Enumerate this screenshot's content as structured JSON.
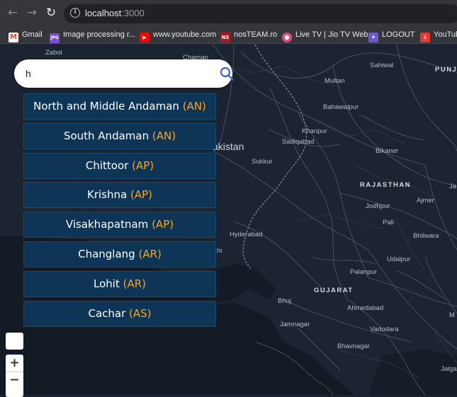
{
  "browser": {
    "url_host": "localhost",
    "url_port": ":3000",
    "bookmarks": [
      {
        "label": "Gmail",
        "icon": "gmail-icon",
        "color": "#ea4335",
        "glyph": "M"
      },
      {
        "label": "Image processing r...",
        "icon": "jpg-icon",
        "color": "#7b4bd8",
        "glyph": "JPG"
      },
      {
        "label": "www.youtube.com",
        "icon": "youtube-icon",
        "color": "#ff0000",
        "glyph": "▶"
      },
      {
        "label": "nosTEAM.ro",
        "icon": "nosteam-icon",
        "color": "#b0151b",
        "glyph": "NS"
      },
      {
        "label": "Live TV | Jio TV Web",
        "icon": "jiotv-icon",
        "color": "#d94a8c",
        "glyph": "●"
      },
      {
        "label": "LOGOUT",
        "icon": "logout-icon",
        "color": "#6a5acd",
        "glyph": "✦"
      },
      {
        "label": "YouTub",
        "icon": "download-icon",
        "color": "#e53935",
        "glyph": "↓"
      }
    ]
  },
  "search": {
    "value": "h"
  },
  "results": [
    {
      "name": "North and Middle Andaman",
      "code": "(AN)"
    },
    {
      "name": "South Andaman",
      "code": "(AN)"
    },
    {
      "name": "Chittoor",
      "code": "(AP)"
    },
    {
      "name": "Krishna",
      "code": "(AP)"
    },
    {
      "name": "Visakhapatnam",
      "code": "(AP)"
    },
    {
      "name": "Changlang",
      "code": "(AR)"
    },
    {
      "name": "Lohit",
      "code": "(AR)"
    },
    {
      "name": "Cachar",
      "code": "(AS)"
    }
  ],
  "map": {
    "places": {
      "zabol": "Zabol",
      "chaman": "Chaman",
      "sahiwal": "Sahiwal",
      "punjab": "PUNJA",
      "multan": "Multan",
      "bahawalpur": "Bahawalpur",
      "khanpur": "Khanpur",
      "sadiqabad": "Sadiqabad",
      "pakistan": "akistan",
      "bikaner": "Bikaner",
      "sukkur": "Sukkur",
      "rajasthan": "RAJASTHAN",
      "ja": "Ja",
      "jodhpur": "Jodhpur",
      "ajmer": "Ajmer",
      "pali": "Pali",
      "bhilwara": "Bhilwara",
      "hyderabad": "Hyderabad",
      "hi": "hi",
      "udaipur": "Udaipur",
      "palanpur": "Palanpur",
      "gujarat": "GUJARAT",
      "bhuj": "Bhuj",
      "ahmedabad": "Ahmedabad",
      "jamnagar": "Jamnagar",
      "vadodara": "Vadodara",
      "bhavnagar": "Bhavnagar",
      "jalga": "Jalga",
      "m": "M"
    },
    "zoom_in": "+",
    "zoom_out": "−"
  }
}
